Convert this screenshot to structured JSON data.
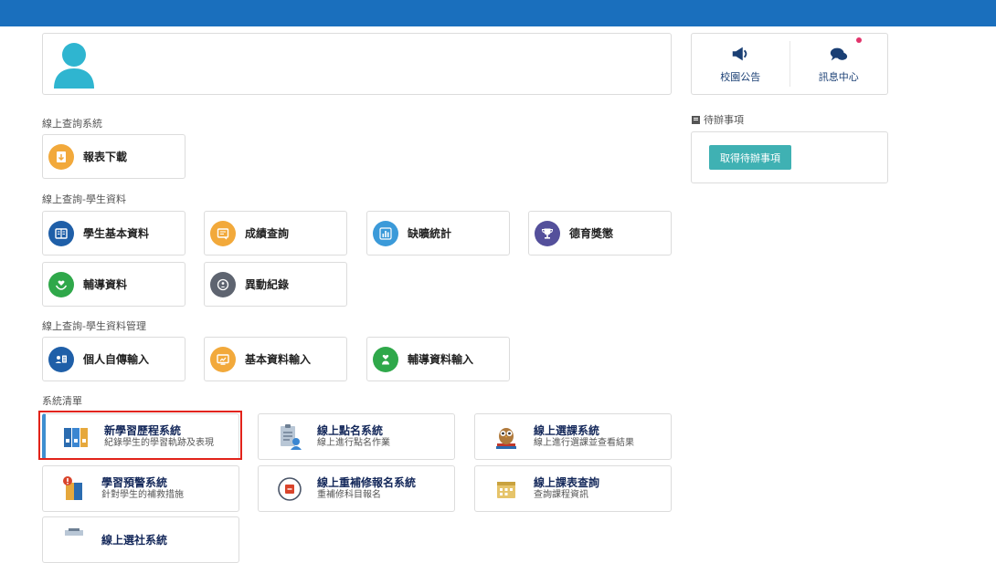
{
  "colors": {
    "topbar": "#1a6fbd",
    "accent_teal": "#3fb1b3",
    "notification_dot": "#e2336b",
    "highlight_border": "#e2231a"
  },
  "quick_links": [
    {
      "label": "校園公告",
      "icon": "megaphone-icon"
    },
    {
      "label": "訊息中心",
      "icon": "chat-bubbles-icon"
    }
  ],
  "todo": {
    "title": "待辦事項",
    "button": "取得待辦事項"
  },
  "sections": {
    "query_system": "線上查詢系統",
    "student_data": "線上查詢-學生資料",
    "student_data_manage": "線上查詢-學生資料管理",
    "system_list": "系統清單"
  },
  "query_tiles": [
    {
      "label": "報表下載",
      "icon": "download-icon"
    }
  ],
  "student_tiles": [
    {
      "label": "學生基本資料",
      "icon": "book-icon"
    },
    {
      "label": "成績查詢",
      "icon": "report-icon"
    },
    {
      "label": "缺曠統計",
      "icon": "bar-chart-icon"
    },
    {
      "label": "德育獎懲",
      "icon": "trophy-icon"
    },
    {
      "label": "輔導資料",
      "icon": "heart-hands-icon"
    },
    {
      "label": "異動紀錄",
      "icon": "record-icon"
    }
  ],
  "manage_tiles": [
    {
      "label": "個人自傳輸入",
      "icon": "profile-card-icon"
    },
    {
      "label": "基本資料輸入",
      "icon": "monitor-icon"
    },
    {
      "label": "輔導資料輸入",
      "icon": "care-icon"
    }
  ],
  "systems": [
    {
      "title": "新學習歷程系統",
      "desc": "紀錄學生的學習軌跡及表現",
      "icon": "binders-icon"
    },
    {
      "title": "線上點名系統",
      "desc": "線上進行點名作業",
      "icon": "roll-call-icon"
    },
    {
      "title": "線上選課系統",
      "desc": "線上進行選課並查看結果",
      "icon": "owl-books-icon"
    },
    {
      "title": "學習預警系統",
      "desc": "針對學生的補救措施",
      "icon": "alert-book-icon"
    },
    {
      "title": "線上重補修報名系統",
      "desc": "重補修科目報名",
      "icon": "clock-register-icon"
    },
    {
      "title": "線上課表查詢",
      "desc": "查詢課程資訊",
      "icon": "calendar-icon"
    },
    {
      "title": "線上選社系統",
      "desc": "",
      "icon": "club-icon"
    }
  ]
}
